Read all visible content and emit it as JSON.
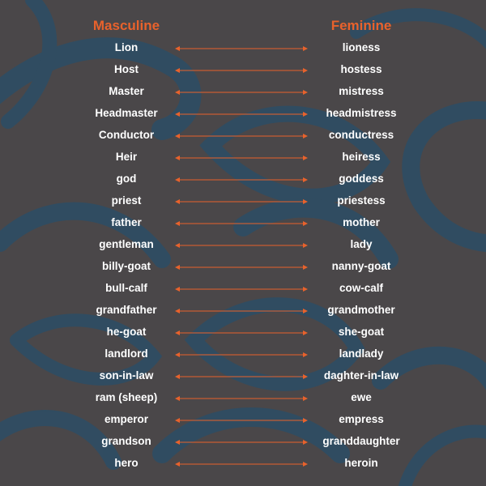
{
  "headers": {
    "masculine": "Masculine",
    "feminine": "Feminine"
  },
  "colors": {
    "accent": "#e8622c",
    "text": "#ffffff",
    "background": "#4a4749",
    "pattern": "#2f4d63"
  },
  "pairs": [
    {
      "masculine": "Lion",
      "feminine": "lioness"
    },
    {
      "masculine": "Host",
      "feminine": "hostess"
    },
    {
      "masculine": "Master",
      "feminine": "mistress"
    },
    {
      "masculine": "Headmaster",
      "feminine": "headmistress"
    },
    {
      "masculine": "Conductor",
      "feminine": "conductress"
    },
    {
      "masculine": "Heir",
      "feminine": "heiress"
    },
    {
      "masculine": "god",
      "feminine": "goddess"
    },
    {
      "masculine": "priest",
      "feminine": "priestess"
    },
    {
      "masculine": "father",
      "feminine": "mother"
    },
    {
      "masculine": "gentleman",
      "feminine": "lady"
    },
    {
      "masculine": "billy-goat",
      "feminine": "nanny-goat"
    },
    {
      "masculine": "bull-calf",
      "feminine": "cow-calf"
    },
    {
      "masculine": "grandfather",
      "feminine": "grandmother"
    },
    {
      "masculine": "he-goat",
      "feminine": "she-goat"
    },
    {
      "masculine": "landlord",
      "feminine": "landlady"
    },
    {
      "masculine": "son-in-law",
      "feminine": "daghter-in-law"
    },
    {
      "masculine": "ram (sheep)",
      "feminine": "ewe"
    },
    {
      "masculine": "emperor",
      "feminine": "empress"
    },
    {
      "masculine": "grandson",
      "feminine": "granddaughter"
    },
    {
      "masculine": "hero",
      "feminine": "heroin"
    }
  ]
}
